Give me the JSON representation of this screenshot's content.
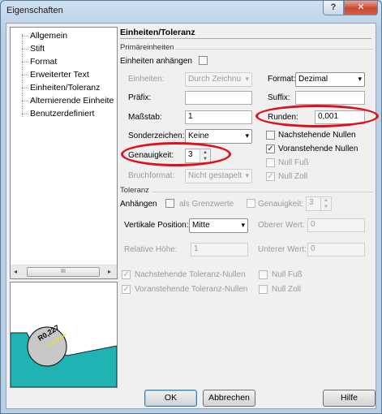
{
  "window": {
    "title": "Eigenschaften",
    "help_button": "?",
    "close_button": "✕"
  },
  "tree": {
    "items": [
      "Allgemein",
      "Stift",
      "Format",
      "Erweiterter Text",
      "Einheiten/Toleranz",
      "Alternierende Einheite",
      "Benutzerdefiniert"
    ],
    "scroll_left": "◂",
    "scroll_right": "▸",
    "scroll_thumb": "III"
  },
  "preview": {
    "dimension_text": "R0,227",
    "colors": {
      "fill": "#1fb3b3",
      "circle": "#c8c8c8"
    }
  },
  "panel": {
    "title": "Einheiten/Toleranz"
  },
  "primary": {
    "group_label": "Primäreinheiten",
    "append_units_label": "Einheiten anhängen",
    "units_label": "Einheiten:",
    "units_value": "Durch Zeichnu",
    "format_label": "Format:",
    "format_value": "Dezimal",
    "prefix_label": "Präfix:",
    "prefix_value": "",
    "suffix_label": "Suffix:",
    "suffix_value": "",
    "scale_label": "Maßstab:",
    "scale_value": "1",
    "round_label": "Runden:",
    "round_value": "0,001",
    "special_label": "Sonderzeichen:",
    "special_value": "Keine",
    "trailing_zeros_label": "Nachstehende Nullen",
    "leading_zeros_label": "Voranstehende Nullen",
    "leading_zeros_checked": true,
    "zero_feet_label": "Null Fuß",
    "zero_inch_label": "Null Zoll",
    "zero_inch_checked": true,
    "precision_label": "Genauigkeit:",
    "precision_value": "3",
    "fraction_label": "Bruchformat:",
    "fraction_value": "Nicht gestapelt"
  },
  "tolerance": {
    "group_label": "Toleranz",
    "append_label": "Anhängen",
    "as_limits_label": "als Grenzwerte",
    "precision_label": "Genauigkeit:",
    "precision_value": "3",
    "vertical_pos_label": "Vertikale Position:",
    "vertical_pos_value": "Mitte",
    "upper_label": "Oberer Wert:",
    "upper_value": "0",
    "rel_height_label": "Relative Höhe:",
    "rel_height_value": "1",
    "lower_label": "Unterer Wert:",
    "lower_value": "0",
    "trailing_tol_label": "Nachstehende Toleranz-Nullen",
    "leading_tol_label": "Voranstehende Toleranz-Nullen",
    "zero_feet_label": "Null Fuß",
    "zero_inch_label": "Null Zoll"
  },
  "buttons": {
    "ok": "OK",
    "cancel": "Abbrechen",
    "help": "Hilfe"
  },
  "colors": {
    "highlight_ellipse": "#e0101a",
    "default_button_border": "#3c7fb1"
  }
}
